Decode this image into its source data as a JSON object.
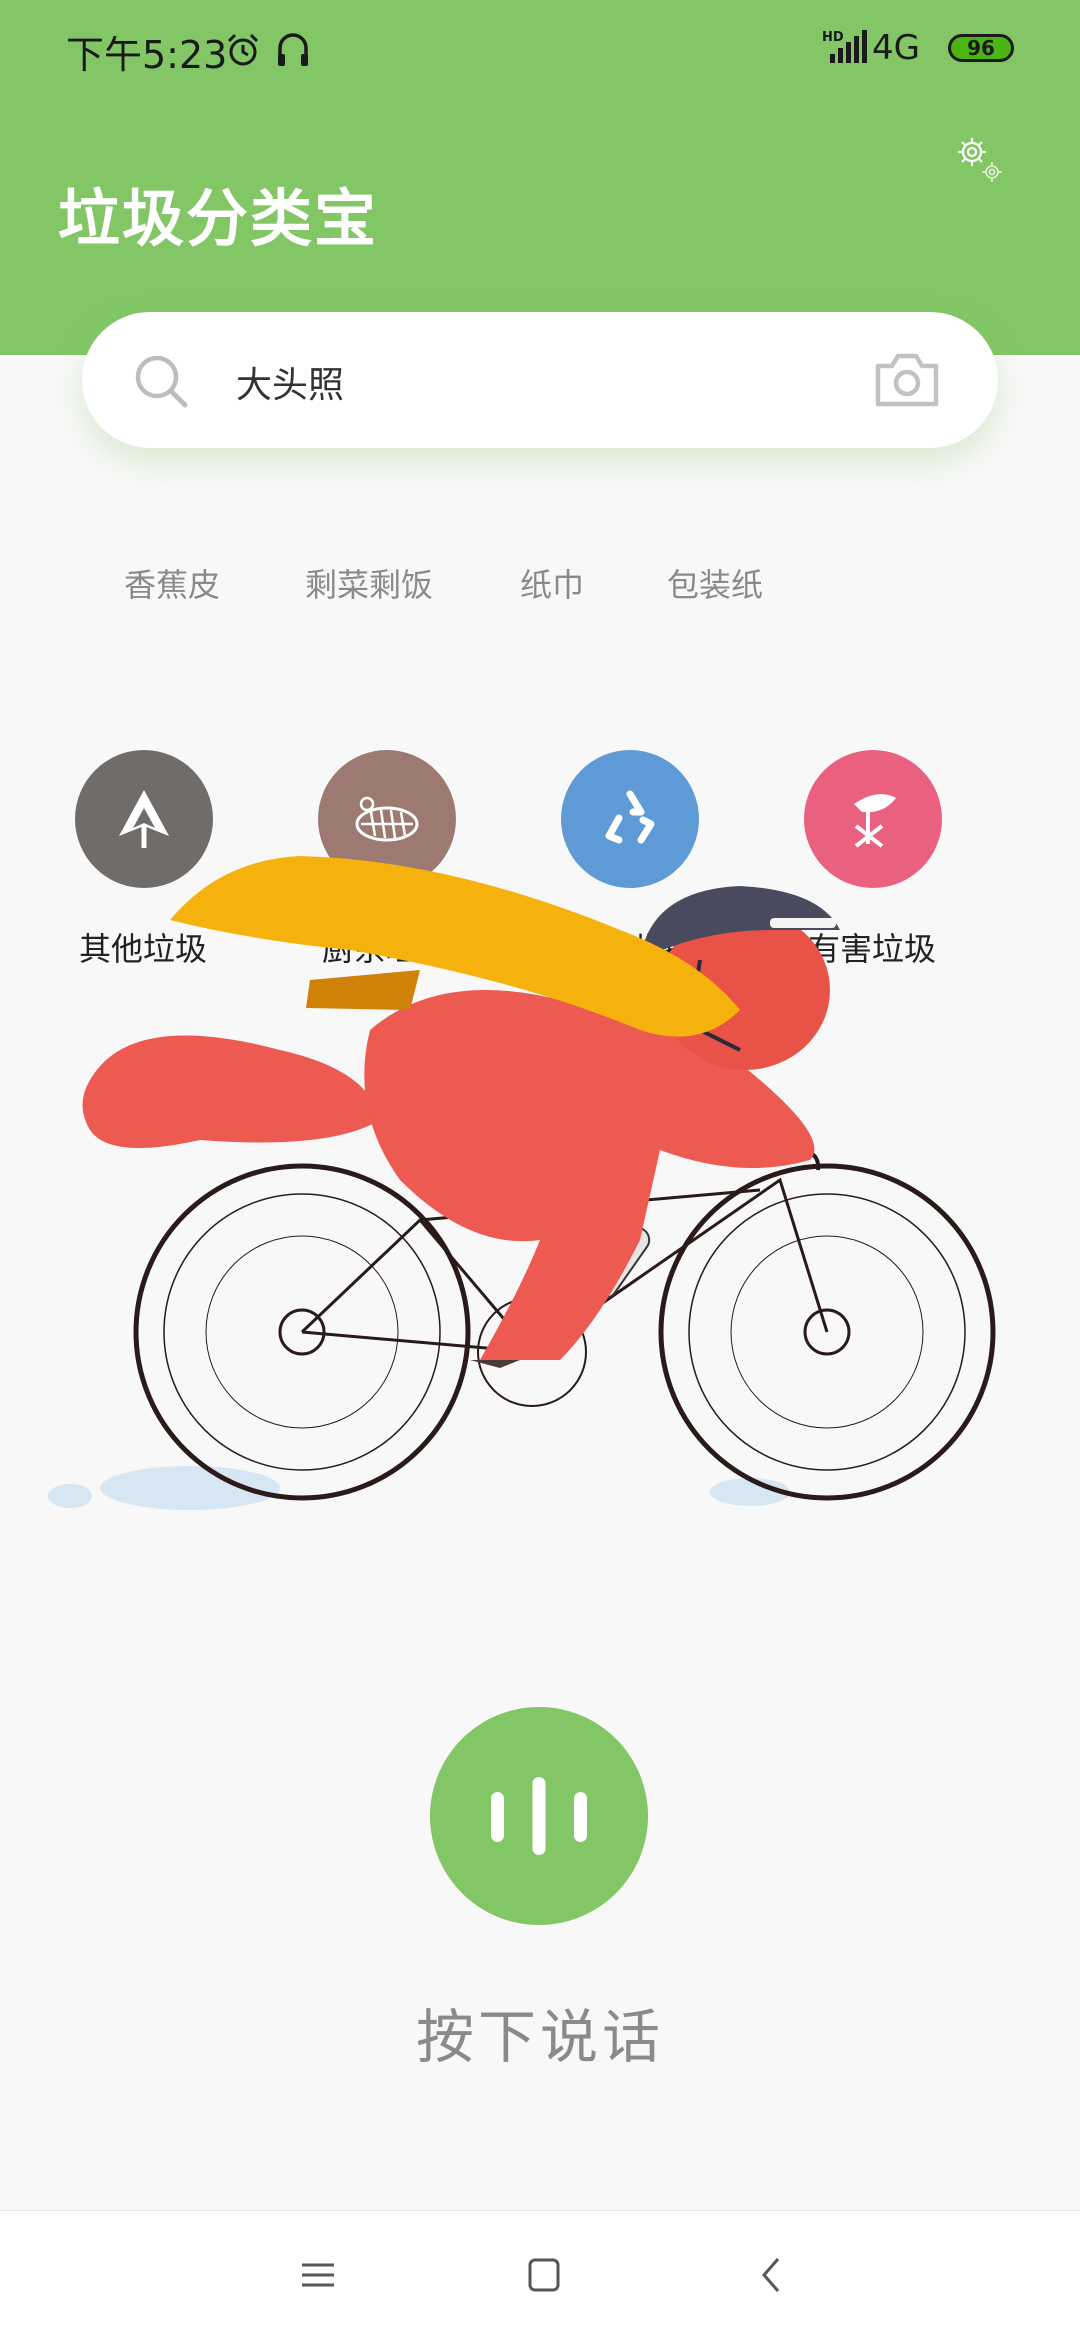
{
  "status_bar": {
    "time": "下午5:23",
    "network": "4G",
    "network_hd": "HD",
    "battery": "96"
  },
  "header": {
    "title": "垃圾分类宝",
    "settings_icon": "gear-icon"
  },
  "search": {
    "value": "大头照",
    "search_icon": "search-icon",
    "camera_icon": "camera-icon"
  },
  "hot_tags": [
    "香蕉皮",
    "剩菜剩饭",
    "纸巾",
    "包装纸"
  ],
  "categories": [
    {
      "label": "其他垃圾",
      "color": "#6f6c6a"
    },
    {
      "label": "厨余垃圾",
      "color": "#9c7a72"
    },
    {
      "label": "可回收物",
      "color": "#5e9bd6"
    },
    {
      "label": "有害垃圾",
      "color": "#e9617f"
    }
  ],
  "voice": {
    "hint": "按下说话",
    "accent": "#82c665"
  },
  "theme": {
    "primary": "#82c665"
  }
}
